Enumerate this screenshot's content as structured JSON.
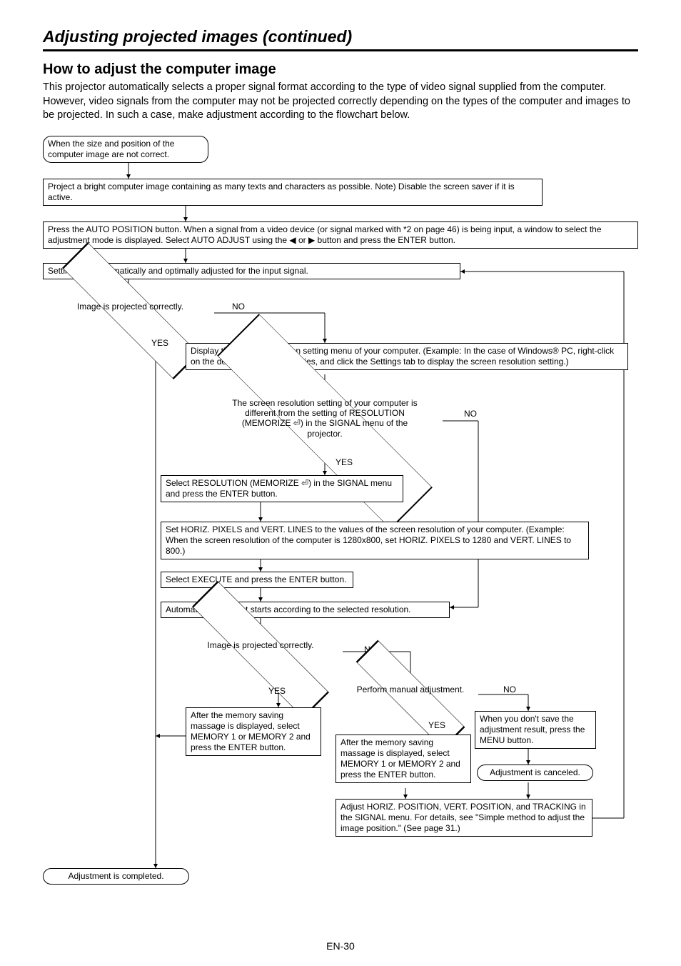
{
  "header": "Adjusting projected images (continued)",
  "title": "How to adjust the computer image",
  "intro": "This projector automatically selects a proper signal format according to the type of video signal supplied from the computer. However, video signals from the computer may not be projected correctly depending on the types of the computer and images to be projected. In such a case, make adjustment according to the flowchart below.",
  "page_number": "EN-30",
  "nodes": {
    "start": "When the size and position of the computer image are not correct.",
    "project_bright": "Project a bright computer image containing as many texts and characters as possible.\nNote) Disable the screen saver if it is active.",
    "auto_position": "Press the AUTO POSITION button. When a signal from a video device (or signal marked with *2 on page 46) is being input, a window to select the adjustment mode is displayed. Select AUTO ADJUST using the ◀ or ▶ button and press the ENTER button.",
    "auto_settings": "Settings are automatically and optimally adjusted for the input signal.",
    "decision1": "Image is projected correctly.",
    "display_res": "Display the screen resolution setting menu of your computer.\n(Example: In the case of Windows® PC, right-click on the desktop, select Properties, and click the Settings tab to display the screen resolution setting.)",
    "decision2": "The screen resolution setting of your computer is different from the setting of RESOLUTION (MEMORIZE ⏎) in the SIGNAL menu of the projector.",
    "select_res": "Select RESOLUTION (MEMORIZE ⏎) in the SIGNAL menu and press the ENTER button.",
    "set_pixels": "Set HORIZ. PIXELS and VERT. LINES to the values of the screen resolution of your computer.\n(Example: When the screen resolution of the computer is 1280x800, set HORIZ. PIXELS to 1280 and VERT. LINES to 800.)",
    "execute": "Select EXECUTE and press the ENTER button.",
    "auto_adj": "Automatic adjustment starts according to the selected resolution.",
    "decision3": "Image is projected correctly.",
    "decision4": "Perform manual adjustment.",
    "mem1": "After the memory saving massage is displayed, select MEMORY 1 or MEMORY 2 and press the ENTER button.",
    "mem2": "After the memory saving massage is displayed, select MEMORY 1 or MEMORY 2 and press the ENTER button.",
    "no_save": "When you don't save the adjustment result, press the MENU button.",
    "canceled": "Adjustment is canceled.",
    "adjust_horiz": "Adjust HORIZ. POSITION, VERT. POSITION, and TRACKING in the SIGNAL menu. For details, see \"Simple method to adjust the image position.\" (See page 31.)",
    "completed": "Adjustment is completed."
  },
  "labels": {
    "yes": "YES",
    "no": "NO"
  }
}
